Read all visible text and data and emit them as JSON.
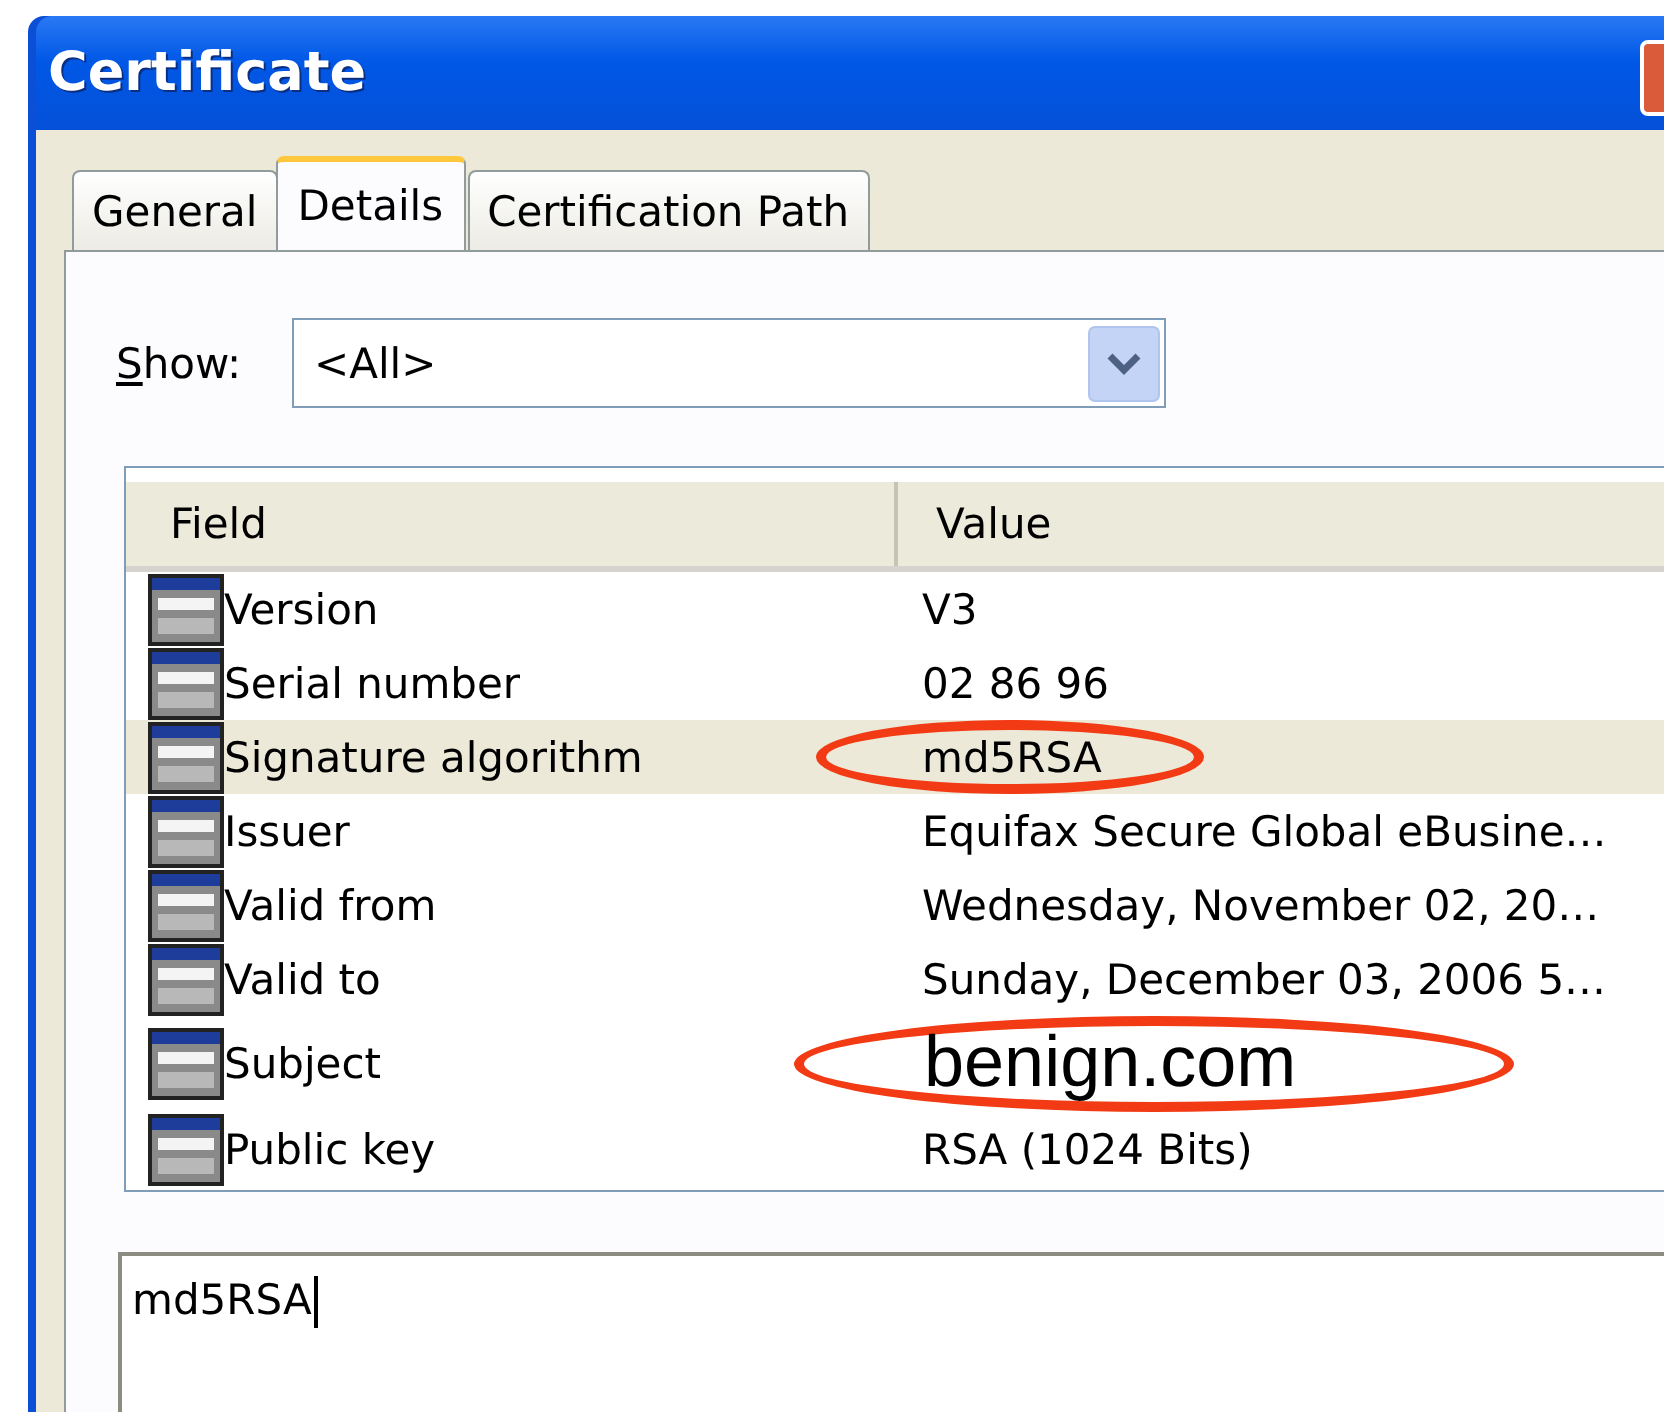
{
  "window": {
    "title": "Certificate"
  },
  "tabs": [
    {
      "label": "General",
      "selected": false
    },
    {
      "label": "Details",
      "selected": true
    },
    {
      "label": "Certification Path",
      "selected": false
    }
  ],
  "show": {
    "label_first": "S",
    "label_rest": "how:",
    "value": "<All>"
  },
  "table": {
    "columns": [
      "Field",
      "Value"
    ],
    "rows": [
      {
        "field": "Version",
        "value": "V3",
        "selected": false,
        "circled": false
      },
      {
        "field": "Serial number",
        "value": "02 86 96",
        "selected": false,
        "circled": false
      },
      {
        "field": "Signature algorithm",
        "value": "md5RSA",
        "selected": true,
        "circled": true
      },
      {
        "field": "Issuer",
        "value": "Equifax Secure Global eBusine…",
        "selected": false,
        "circled": false
      },
      {
        "field": "Valid from",
        "value": "Wednesday, November 02, 20…",
        "selected": false,
        "circled": false
      },
      {
        "field": "Valid to",
        "value": "Sunday, December 03, 2006 5…",
        "selected": false,
        "circled": false
      },
      {
        "field": "Subject",
        "overlay_text": "benign.com",
        "selected": false,
        "circled": true
      },
      {
        "field": "Public key",
        "value": "RSA (1024 Bits)",
        "selected": false,
        "circled": false
      }
    ]
  },
  "detail_text": "md5RSA"
}
